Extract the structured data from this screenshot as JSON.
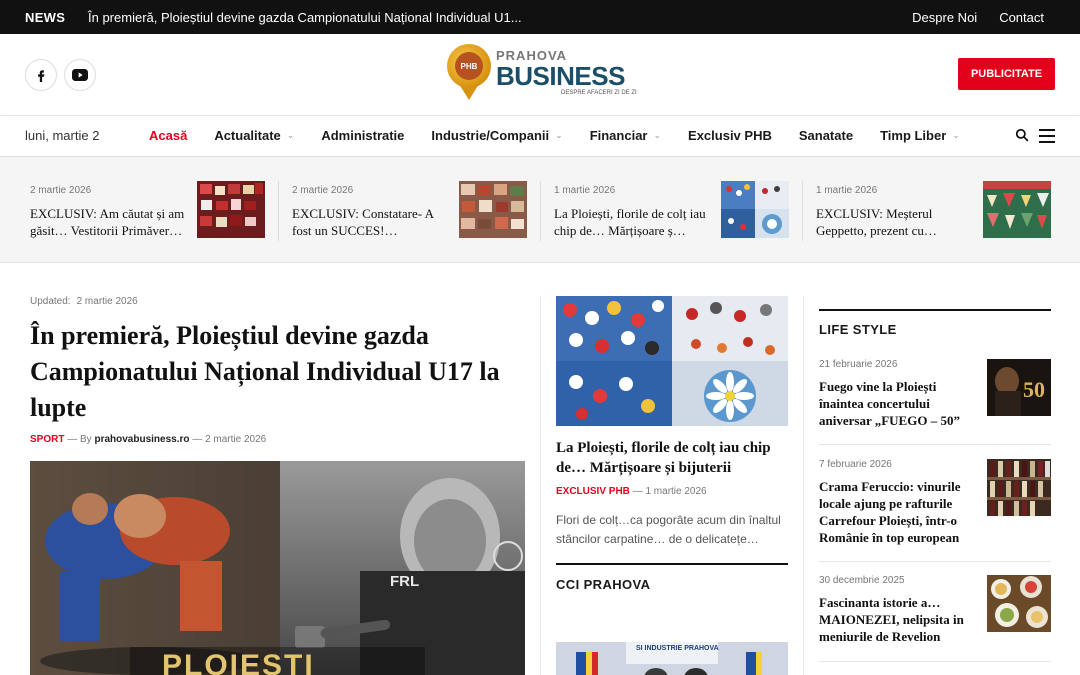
{
  "topbar": {
    "label": "NEWS",
    "ticker": "În premieră, Ploieștiul devine gazda Campionatului Național Individual U1...",
    "links": [
      "Despre Noi",
      "Contact"
    ]
  },
  "header": {
    "logo_prahova": "PRAHOVA",
    "logo_business": "BUSINESS",
    "logo_tagline": "DESPRE AFACERI ZI DE ZI",
    "publicitate": "PUBLICITATE",
    "social": [
      "facebook-icon",
      "youtube-icon"
    ]
  },
  "nav": {
    "date": "luni, martie 2",
    "items": [
      {
        "label": "Acasă",
        "active": true,
        "dropdown": false
      },
      {
        "label": "Actualitate",
        "active": false,
        "dropdown": true
      },
      {
        "label": "Administratie",
        "active": false,
        "dropdown": false
      },
      {
        "label": "Industrie/Companii",
        "active": false,
        "dropdown": true
      },
      {
        "label": "Financiar",
        "active": false,
        "dropdown": true
      },
      {
        "label": "Exclusiv PHB",
        "active": false,
        "dropdown": false
      },
      {
        "label": "Sanatate",
        "active": false,
        "dropdown": false
      },
      {
        "label": "Timp Liber",
        "active": false,
        "dropdown": true
      }
    ]
  },
  "strip": [
    {
      "date": "2 martie 2026",
      "title": "EXCLUSIV: Am căutat și am găsit… Vestitorii Primăver…"
    },
    {
      "date": "2 martie 2026",
      "title": "EXCLUSIV: Constatare- A fost un SUCCES!…"
    },
    {
      "date": "1 martie 2026",
      "title": "La Ploiești, florile de colț iau chip de… Mărțișoare ș…"
    },
    {
      "date": "1 martie 2026",
      "title": "EXCLUSIV: Meșterul Geppetto, prezent cu…"
    }
  ],
  "main": {
    "updated_label": "Updated:",
    "updated_date": "2 martie 2026",
    "title": "În premieră, Ploieștiul devine gazda Campionatului Național Individual U17 la lupte",
    "category": "SPORT",
    "by": "By",
    "author": "prahovabusiness.ro",
    "date": "2 martie 2026",
    "hero_text": "PLOIEȘTI",
    "hero_shirt": "FRL"
  },
  "mid": {
    "title": "La Ploiești, florile de colț iau chip de… Mărțișoare și bijuterii",
    "category": "EXCLUSIV PHB",
    "date": "1 martie 2026",
    "excerpt": "Flori de colț…ca pogorâte acum din înaltul stâncilor carpatine… de o delicatețe…",
    "section": "CCI PRAHOVA",
    "cci_caption": "SI INDUSTRIE PRAHOVA"
  },
  "side": {
    "section": "LIFE STYLE",
    "items": [
      {
        "date": "21 februarie 2026",
        "title": "Fuego vine la Ploiești înaintea concertului aniversar „FUEGO – 50”"
      },
      {
        "date": "7 februarie 2026",
        "title": "Crama Feruccio: vinurile locale ajung pe rafturile Carrefour Ploiești, într-o Românie în top european"
      },
      {
        "date": "30 decembrie 2025",
        "title": "Fascinanta istorie a… MAIONEZEI, nelipsita in meniurile de Revelion"
      }
    ]
  },
  "colors": {
    "accent": "#e3001b",
    "topbar": "#111111",
    "logo_blue": "#1b4e68"
  }
}
